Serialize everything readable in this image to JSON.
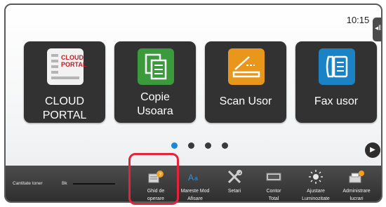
{
  "status": {
    "time": "10:15"
  },
  "tiles": [
    {
      "label": "CLOUD PORTAL",
      "icon": "cloud-portal-icon",
      "icon_text": "CLOUD PORTAL"
    },
    {
      "label_line1": "Copie",
      "label_line2": "Usoara",
      "icon": "copy-icon"
    },
    {
      "label": "Scan Usor",
      "icon": "scanner-icon"
    },
    {
      "label": "Fax usor",
      "icon": "fax-icon"
    }
  ],
  "pagination": {
    "pages": 4,
    "current": 1
  },
  "toner": {
    "label": "Cantitate toner",
    "color": "Bk"
  },
  "bottom_items": [
    {
      "line1": "Ghid de",
      "line2": "operare",
      "icon": "operation-guide-icon"
    },
    {
      "line1": "Mareste Mod",
      "line2": "Afisare",
      "icon": "enlarge-display-icon"
    },
    {
      "line1": "Setari",
      "line2": "",
      "icon": "settings-icon"
    },
    {
      "line1": "Contor",
      "line2": "Total",
      "icon": "total-count-icon"
    },
    {
      "line1": "Ajustare",
      "line2": "Luminozitate",
      "icon": "brightness-icon"
    },
    {
      "line1": "Administrare",
      "line2": "lucrari",
      "icon": "job-status-icon"
    }
  ],
  "colors": {
    "tile_bg": "#323232",
    "active_dot": "#1f86d6",
    "highlight": "#e5243b"
  }
}
